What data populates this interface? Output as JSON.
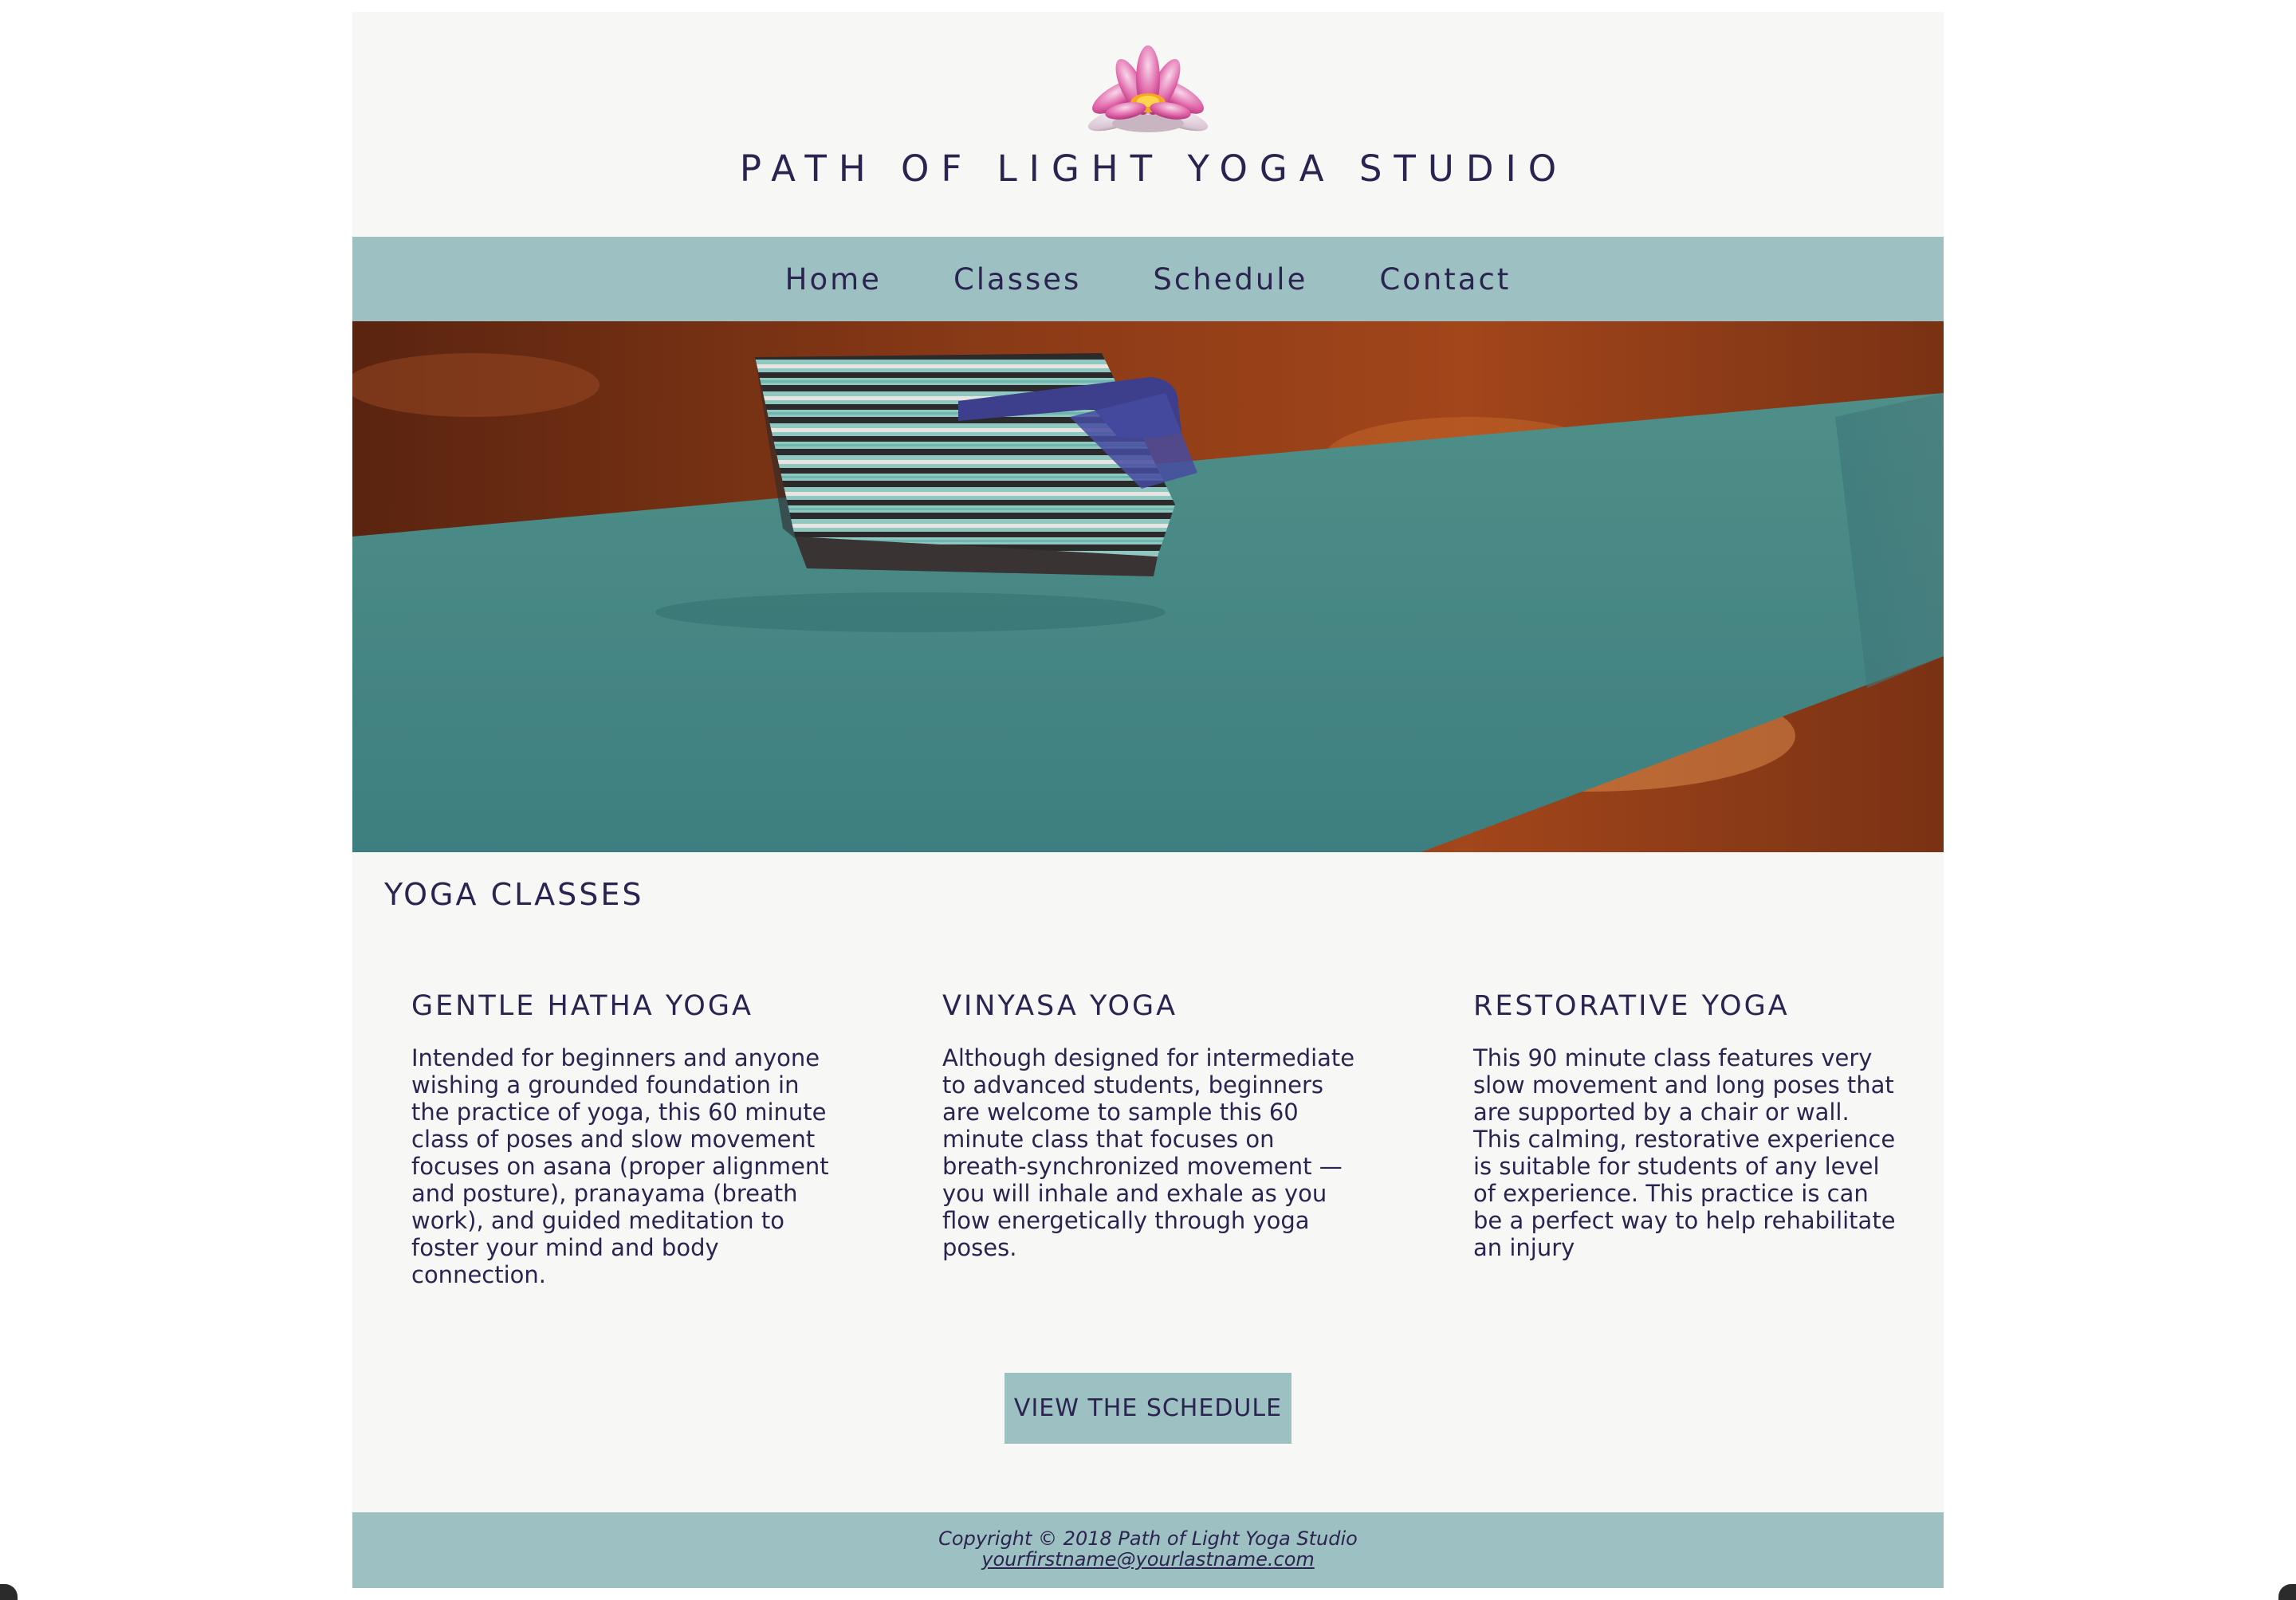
{
  "header": {
    "logo_icon": "lotus-flower-icon",
    "title": "PATH OF LIGHT YOGA STUDIO"
  },
  "nav": {
    "items": [
      {
        "label": "Home"
      },
      {
        "label": "Classes"
      },
      {
        "label": "Schedule"
      },
      {
        "label": "Contact"
      }
    ]
  },
  "hero": {
    "image": "yoga-mat-with-folded-blanket-and-strap"
  },
  "main": {
    "heading": "YOGA CLASSES",
    "classes": [
      {
        "title": "GENTLE HATHA YOGA",
        "description": "Intended for beginners and anyone wishing a grounded foundation in the practice of yoga, this 60 minute class of poses and slow movement focuses on asana (proper alignment and posture), pranayama (breath work), and guided meditation to foster your mind and body connection."
      },
      {
        "title": "VINYASA YOGA",
        "description": "Although designed for intermediate to advanced students, beginners are welcome to sample this 60 minute class that focuses on breath-synchronized movement — you will inhale and exhale as you flow energetically through yoga poses."
      },
      {
        "title": "RESTORATIVE YOGA",
        "description": "This 90 minute class features very slow movement and long poses that are supported by a chair or wall. This calming, restorative experience is suitable for students of any level of experience. This practice is can be a perfect way to help rehabilitate an injury"
      }
    ],
    "cta_label": "VIEW THE SCHEDULE"
  },
  "footer": {
    "copyright": "Copyright © 2018 Path of Light Yoga Studio",
    "email": "yourfirstname@yourlastname.com"
  },
  "colors": {
    "accent": "#9dc1c2",
    "text": "#2c2450",
    "page_background": "#f7f7f5"
  }
}
